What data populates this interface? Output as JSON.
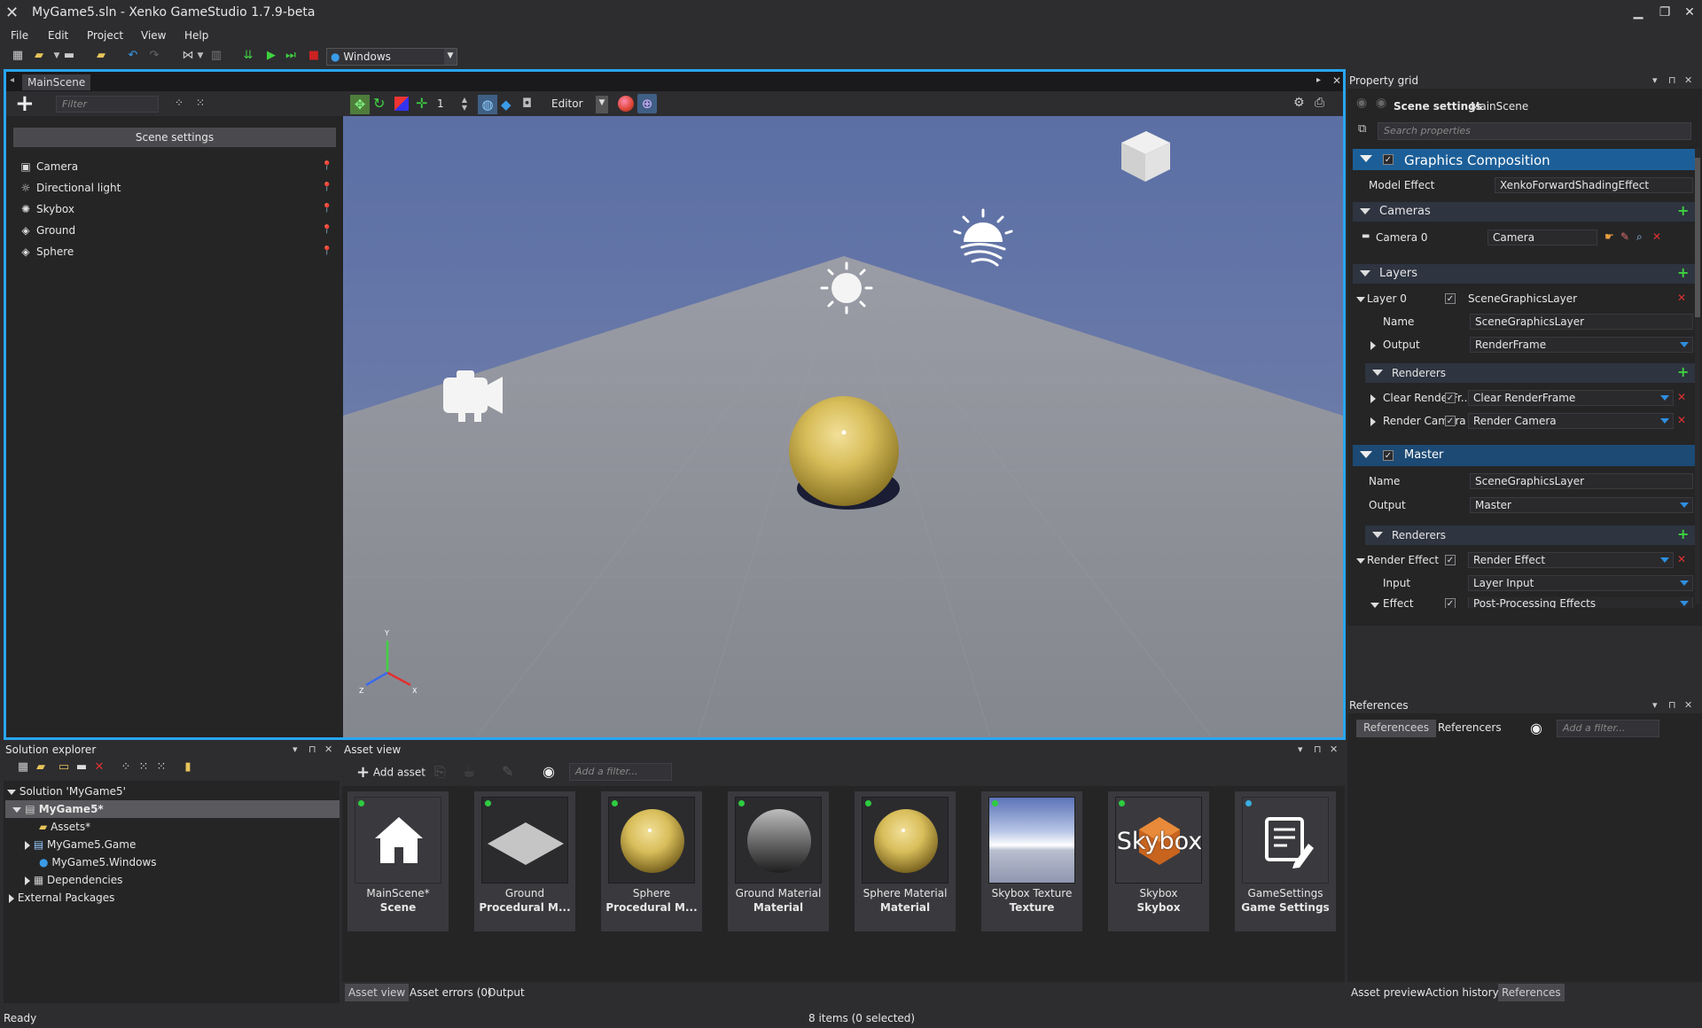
{
  "window": {
    "title": "MyGame5.sln - Xenko GameStudio 1.7.9-beta"
  },
  "menu": [
    "File",
    "Edit",
    "Project",
    "View",
    "Help"
  ],
  "toolbar": {
    "platform": "Windows"
  },
  "scene_editor": {
    "tab": "MainScene",
    "filter_placeholder": "Filter",
    "scene_settings_label": "Scene settings",
    "entities": [
      {
        "name": "Camera",
        "icon": "camera-icon"
      },
      {
        "name": "Directional light",
        "icon": "sun-icon"
      },
      {
        "name": "Skybox",
        "icon": "skybox-icon"
      },
      {
        "name": "Ground",
        "icon": "entity-icon"
      },
      {
        "name": "Sphere",
        "icon": "entity-icon"
      }
    ],
    "snap_value": "1",
    "camera_mode": "Editor",
    "axis_labels": {
      "x": "X",
      "y": "Y",
      "z": "Z"
    }
  },
  "property_grid": {
    "title": "Property grid",
    "header_bold": "Scene settings",
    "header_name": "MainScene",
    "search_placeholder": "Search properties",
    "graphics_composition": "Graphics Composition",
    "model_effect_label": "Model Effect",
    "model_effect_value": "XenkoForwardShadingEffect",
    "cameras_label": "Cameras",
    "camera0_label": "Camera 0",
    "camera0_value": "Camera",
    "layers_label": "Layers",
    "layer0_label": "Layer 0",
    "layer0_value": "SceneGraphicsLayer",
    "name_label": "Name",
    "name_value": "SceneGraphicsLayer",
    "output_label": "Output",
    "output_value": "RenderFrame",
    "renderers_label": "Renderers",
    "clear_label": "Clear RenderFr...",
    "clear_value": "Clear RenderFrame",
    "render_camera_label": "Render Camera",
    "render_camera_value": "Render Camera",
    "master_label": "Master",
    "master_name_label": "Name",
    "master_name_value": "SceneGraphicsLayer",
    "master_output_label": "Output",
    "master_output_value": "Master",
    "master_renderers_label": "Renderers",
    "render_effect_label": "Render Effect",
    "render_effect_value": "Render Effect",
    "input_label": "Input",
    "input_value": "Layer Input",
    "effect_label": "Effect",
    "effect_value": "Post-Processing Effects"
  },
  "references": {
    "title": "References",
    "tabs": [
      "Referencees",
      "Referencers"
    ],
    "filter_placeholder": "Add a filter..."
  },
  "solution_explorer": {
    "title": "Solution explorer",
    "items": [
      {
        "label": "Solution 'MyGame5'"
      },
      {
        "label": "MyGame5*"
      },
      {
        "label": "Assets*"
      },
      {
        "label": "MyGame5.Game"
      },
      {
        "label": "MyGame5.Windows"
      },
      {
        "label": "Dependencies"
      },
      {
        "label": "External Packages"
      }
    ]
  },
  "asset_view": {
    "title": "Asset view",
    "add_asset_label": "Add asset",
    "filter_placeholder": "Add a filter...",
    "assets": [
      {
        "name": "MainScene*",
        "type": "Scene",
        "thumb": "scene-icon"
      },
      {
        "name": "Ground",
        "type": "Procedural M...",
        "thumb": "plane"
      },
      {
        "name": "Sphere",
        "type": "Procedural M...",
        "thumb": "yellow-sphere"
      },
      {
        "name": "Ground Material",
        "type": "Material",
        "thumb": "grey-sphere"
      },
      {
        "name": "Sphere Material",
        "type": "Material",
        "thumb": "yellow-sphere"
      },
      {
        "name": "Skybox Texture",
        "type": "Texture",
        "thumb": "sky"
      },
      {
        "name": "Skybox",
        "type": "Skybox",
        "thumb": "skybox-logo"
      },
      {
        "name": "GameSettings",
        "type": "Game Settings",
        "thumb": "settings-icon"
      }
    ],
    "skybox_logo_text": "Skybox"
  },
  "bottom_tabs_center": [
    "Asset view",
    "Asset errors (0)",
    "Output"
  ],
  "bottom_tabs_right": [
    "Asset preview",
    "Action history",
    "References"
  ],
  "status": {
    "left": "Ready",
    "center": "8 items (0 selected)"
  },
  "colors": {
    "accent": "#28a6f0",
    "section": "#1c5f98",
    "sphere": "#d8bd5a",
    "sky": "#6b7bab"
  }
}
